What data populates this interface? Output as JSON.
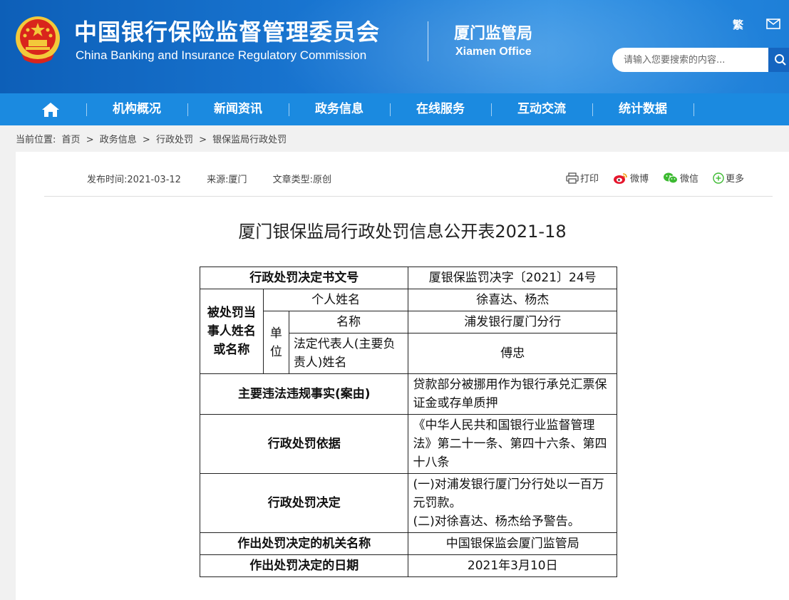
{
  "header": {
    "title_cn": "中国银行保险监督管理委员会",
    "title_en": "China Banking and Insurance Regulatory Commission",
    "office_cn": "厦门监管局",
    "office_en": "Xiamen Office",
    "traditional_label": "繁",
    "search_placeholder": "请输入您要搜索的内容..."
  },
  "nav": {
    "items": [
      "机构概况",
      "新闻资讯",
      "政务信息",
      "在线服务",
      "互动交流",
      "统计数据"
    ]
  },
  "breadcrumb": {
    "label": "当前位置:",
    "items": [
      "首页",
      ">",
      "政务信息",
      ">",
      "行政处罚",
      ">",
      "银保监局行政处罚"
    ]
  },
  "article": {
    "publish_time": "发布时间:2021-03-12",
    "source": "来源:厦门",
    "type": "文章类型:原创",
    "share": [
      "打印",
      "微博",
      "微信",
      "更多"
    ],
    "title": "厦门银保监局行政处罚信息公开表2021-18"
  },
  "table": {
    "doc_no_label": "行政处罚决定书文号",
    "doc_no_value": "厦银保监罚决字〔2021〕24号",
    "party_label": "被处罚当事人姓名或名称",
    "personal_label": "个人姓名",
    "personal_value": "徐喜达、杨杰",
    "unit_label": "单位",
    "unit_name_label": "名称",
    "unit_name_value": "浦发银行厦门分行",
    "legal_rep_label": "法定代表人(主要负责人)姓名",
    "legal_rep_value": "傅忠",
    "facts_label": "主要违法违规事实(案由)",
    "facts_value": "贷款部分被挪用作为银行承兑汇票保证金或存单质押",
    "basis_label": "行政处罚依据",
    "basis_value": "《中华人民共和国银行业监督管理法》第二十一条、第四十六条、第四十八条",
    "decision_label": "行政处罚决定",
    "decision_value_1": "(一)对浦发银行厦门分行处以一百万元罚款。",
    "decision_value_2": "(二)对徐喜达、杨杰给予警告。",
    "authority_label": "作出处罚决定的机关名称",
    "authority_value": "中国银保监会厦门监管局",
    "date_label": "作出处罚决定的日期",
    "date_value": "2021年3月10日"
  },
  "colors": {
    "header_blue": "#1a78d4",
    "nav_blue": "#1b8ae0",
    "emblem_red": "#d9251c",
    "emblem_gold": "#f3c93a"
  }
}
